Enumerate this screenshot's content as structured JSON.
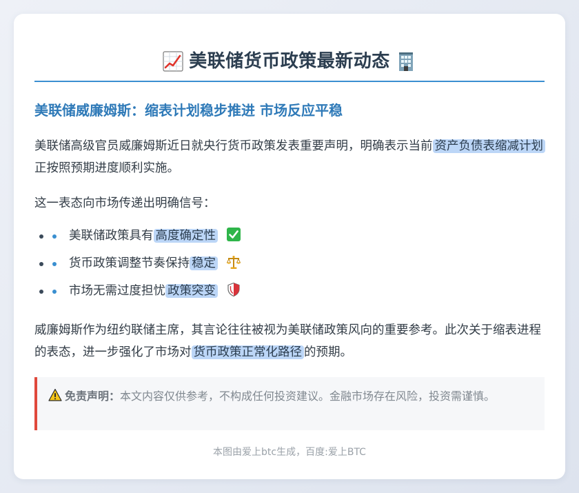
{
  "article": {
    "title": "美联储货币政策最新动态",
    "title_icon_left": "chart-increasing-icon",
    "title_icon_right": "office-building-icon",
    "subtitle": "美联储威廉姆斯：缩表计划稳步推进 市场反应平稳",
    "p1": {
      "before": "美联储高级官员威廉姆斯近日就央行货币政策发表重要声明，明确表示当前",
      "highlight": "资产负债表缩减计划",
      "after": "正按照预期进度顺利实施。"
    },
    "p2": "这一表态向市场传递出明确信号：",
    "bullets": [
      {
        "text": "美联储政策具有",
        "highlight": "高度确定性",
        "icon": "check-mark-icon"
      },
      {
        "text": "货币政策调整节奏保持",
        "highlight": "稳定",
        "icon": "balance-scale-icon"
      },
      {
        "text": "市场无需过度担忧",
        "highlight": "政策突变",
        "icon": "shield-icon"
      }
    ],
    "p3": {
      "before": "威廉姆斯作为纽约联储主席，其言论往往被视为美联储政策风向的重要参考。此次关于缩表进程的表态，进一步强化了市场对",
      "highlight": "货币政策正常化路径",
      "after": "的预期。"
    },
    "disclaimer": {
      "icon": "warning-icon",
      "label": "免责声明：",
      "text": "本文内容仅供参考，不构成任何投资建议。金融市场存在风险，投资需谨慎。"
    },
    "footer": "本图由爱上btc生成，百度:爱上BTC"
  },
  "colors": {
    "accent": "#3a8fd0",
    "subtitle": "#2f7ab8",
    "highlight": "#bcd6f7",
    "disclaimer_border": "#e0483c"
  }
}
